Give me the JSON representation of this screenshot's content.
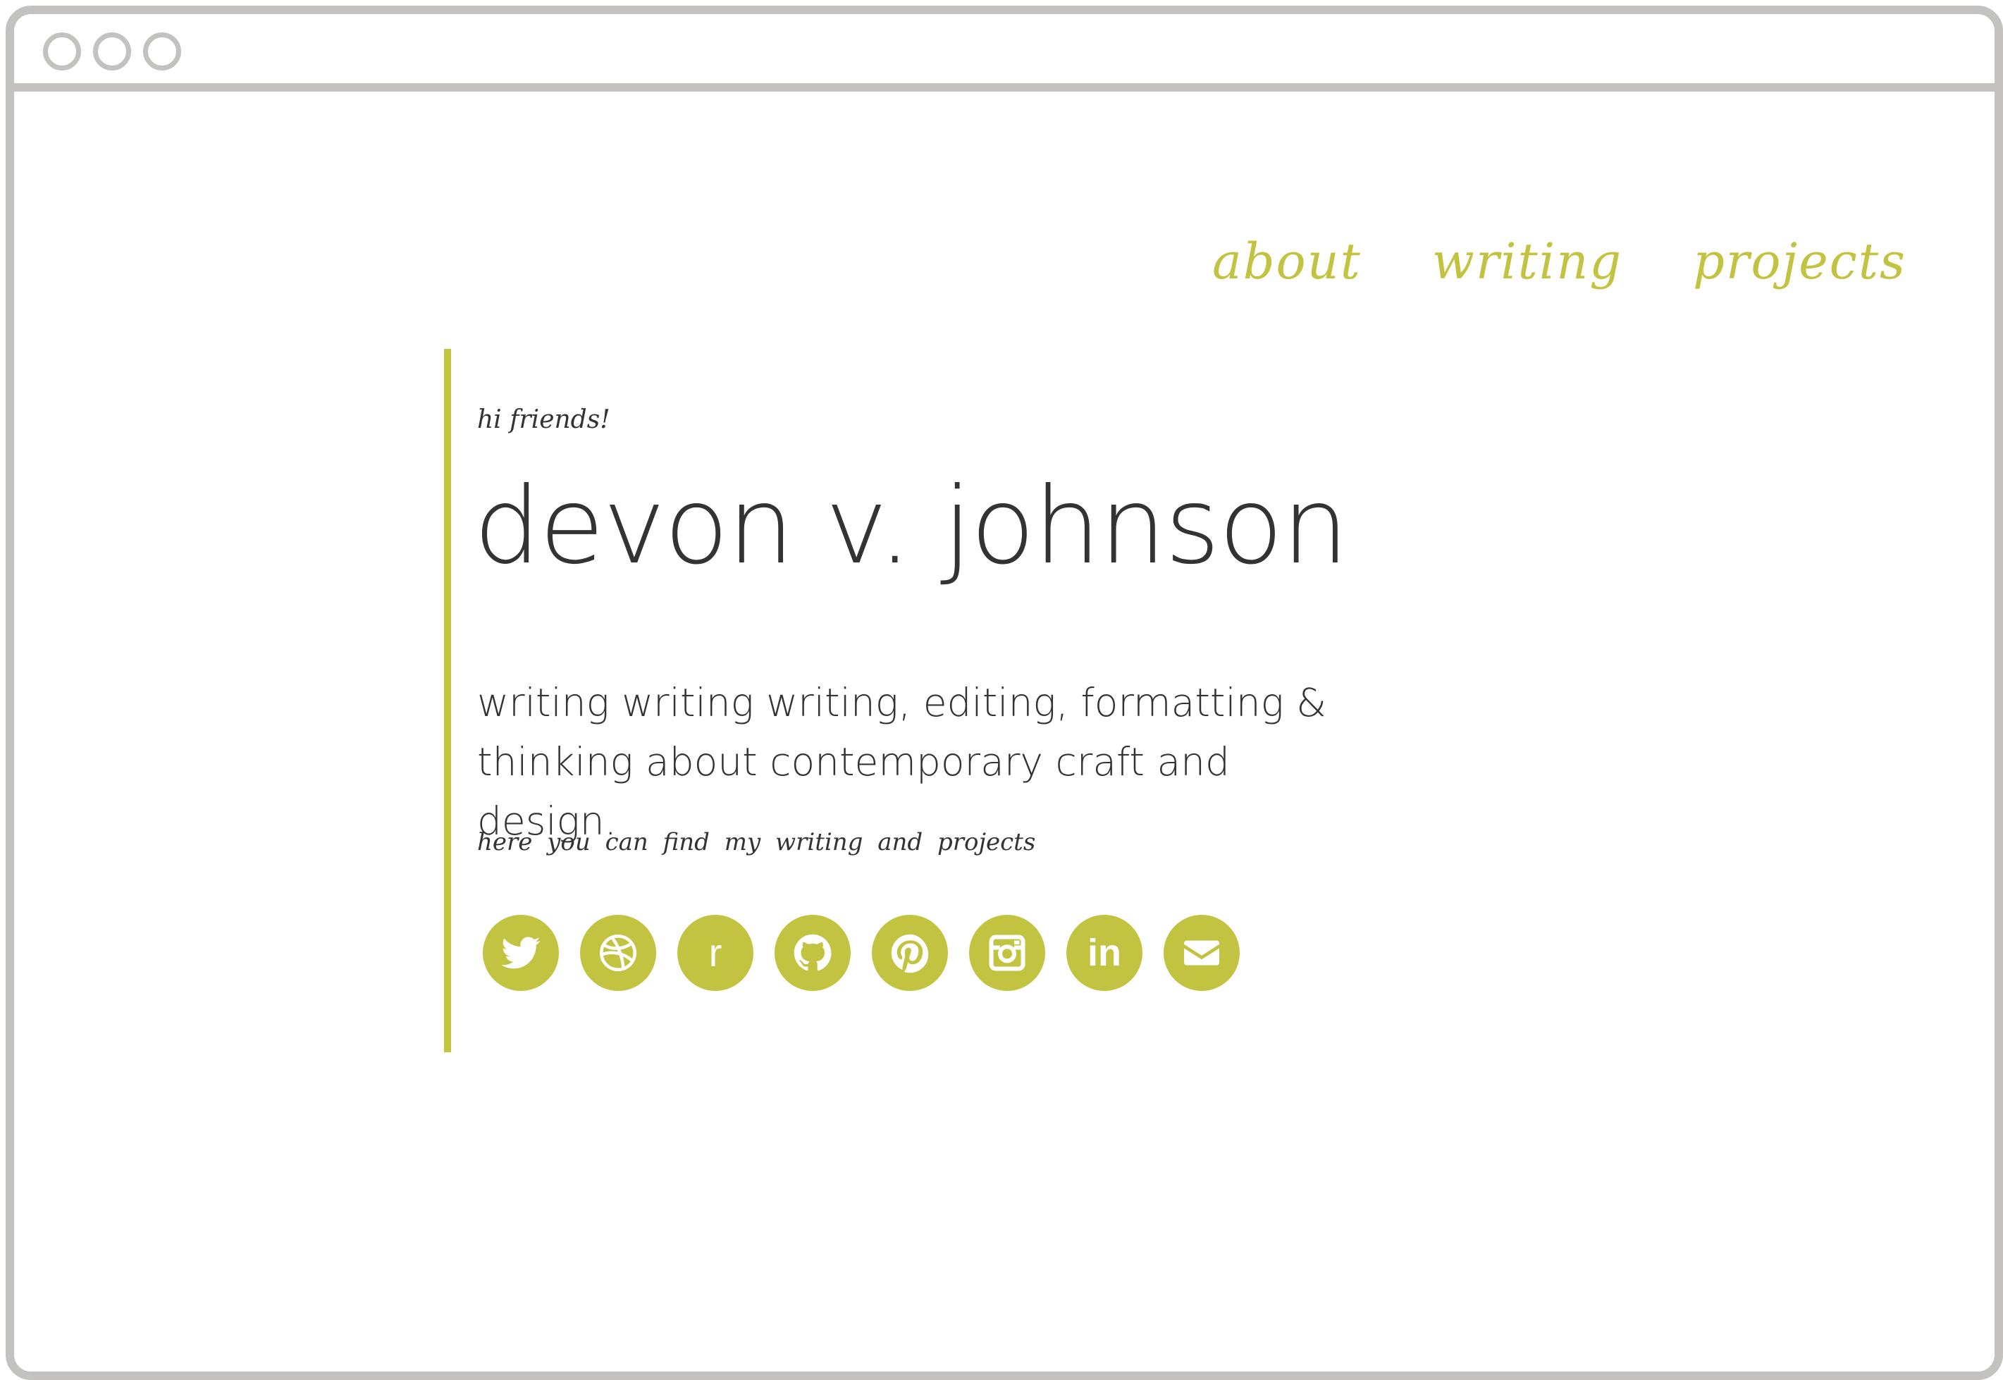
{
  "window": {
    "controls": [
      "window-close",
      "window-minimize",
      "window-maximize"
    ]
  },
  "nav": {
    "items": [
      {
        "label": "about"
      },
      {
        "label": "writing"
      },
      {
        "label": "projects"
      }
    ]
  },
  "hero": {
    "greeting": "hi friends!",
    "name": "devon v. johnson",
    "tagline_line1": "writing writing writing, editing, formatting &",
    "tagline_line2": "thinking about contemporary craft and design.",
    "subtext": "here you can find my writing and projects"
  },
  "social": {
    "icons": [
      "twitter-icon",
      "dribbble-icon",
      "r-icon",
      "github-icon",
      "pinterest-icon",
      "instagram-icon",
      "linkedin-icon",
      "email-icon"
    ],
    "r_glyph": "r",
    "linkedin_glyph": "in"
  },
  "colors": {
    "accent": "#c3c342",
    "text": "#333333",
    "frame": "#c4c2c1",
    "background": "#ffffff"
  }
}
